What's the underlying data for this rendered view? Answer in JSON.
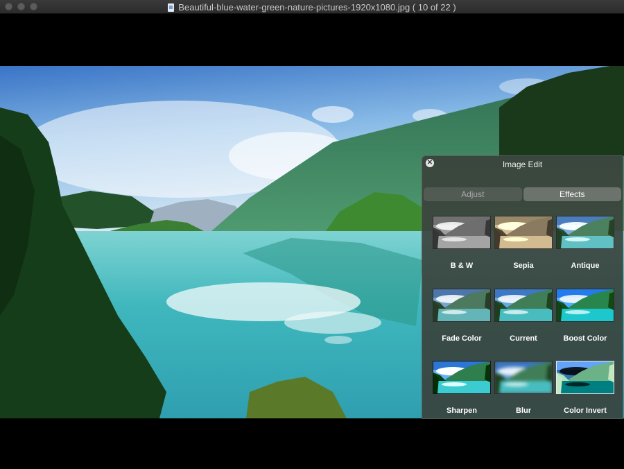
{
  "window": {
    "title": "Beautiful-blue-water-green-nature-pictures-1920x1080.jpg ( 10 of 22 )",
    "file_icon": "image-file-icon"
  },
  "panel": {
    "title": "Image Edit",
    "close_icon": "close-icon",
    "tabs": [
      {
        "label": "Adjust",
        "selected": false
      },
      {
        "label": "Effects",
        "selected": true
      }
    ],
    "effects": [
      {
        "label": "B & W"
      },
      {
        "label": "Sepia"
      },
      {
        "label": "Antique"
      },
      {
        "label": "Fade Color"
      },
      {
        "label": "Current"
      },
      {
        "label": "Boost Color"
      },
      {
        "label": "Sharpen"
      },
      {
        "label": "Blur"
      },
      {
        "label": "Color Invert"
      }
    ]
  },
  "colors": {
    "panel_bg": "#3a403a",
    "sky": "#7fb6e6",
    "water": "#3fb8be",
    "mountain": "#3d8a58"
  }
}
